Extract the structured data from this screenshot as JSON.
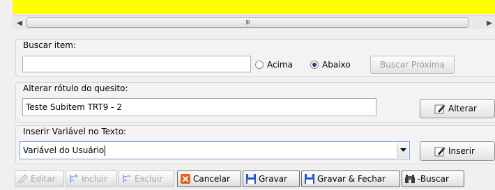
{
  "scrollbar": {
    "thumb_grip": "III"
  },
  "search": {
    "label": "Buscar item:",
    "value": "",
    "radio_up_label": "Acima",
    "radio_down_label": "Abaixo",
    "selected_direction": "Abaixo",
    "next_button": "Buscar Próxima"
  },
  "rename": {
    "label": "Alterar rótulo do quesito:",
    "value": "Teste Subitem TRT9 - 2",
    "button": "Alterar"
  },
  "insert_var": {
    "label": "Inserir Variável no Texto:",
    "value": "Variável do Usuário",
    "button": "Inserir"
  },
  "toolbar": {
    "edit": "Editar",
    "include": "Incluir",
    "delete": "Excluir",
    "cancel": "Cancelar",
    "save": "Gravar",
    "save_close": "Gravar & Fechar",
    "search": "-Buscar"
  },
  "colors": {
    "yellow_bar": "#ffff00",
    "cancel_icon": "#e8601c",
    "save_icon": "#2456c6"
  }
}
